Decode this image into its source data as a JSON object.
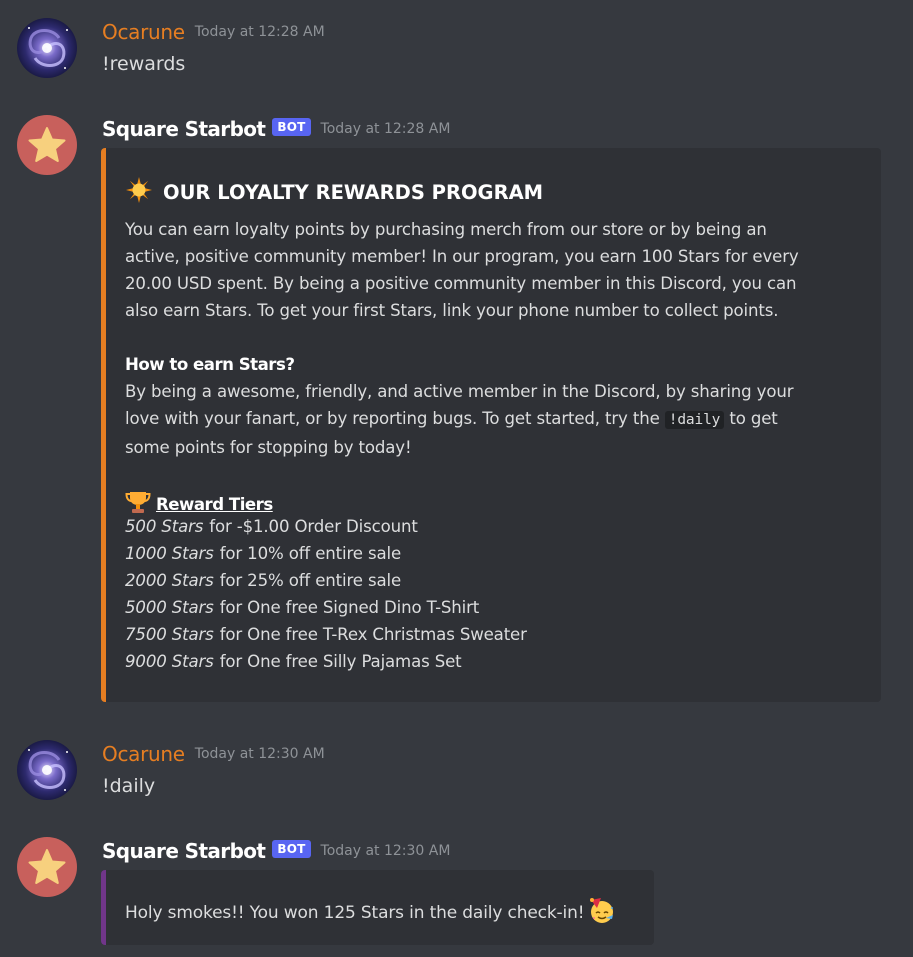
{
  "colors": {
    "background": "#36393f",
    "embed_background": "#2f3136",
    "user_name": "#e67e22",
    "bot_tag": "#5865f2",
    "rewards_embed_bar": "#e67e22",
    "daily_embed_bar": "#71368a",
    "timestamp": "#8e9297"
  },
  "messages": [
    {
      "author": "Ocarune",
      "timestamp": "Today at 12:28 AM",
      "avatar_icon": "galaxy-avatar-icon",
      "content": "!rewards"
    },
    {
      "author": "Square Starbot",
      "bot_tag": "BOT",
      "timestamp": "Today at 12:28 AM",
      "avatar_icon": "star-avatar-icon",
      "embed": {
        "title_icon": "sun-icon",
        "title": "OUR LOYALTY REWARDS PROGRAM",
        "intro_lines": [
          "You can earn loyalty points by purchasing merch from our store or by being an",
          "active, positive community member! In our program, you earn 100 Stars for every",
          "20.00 USD spent. By being a positive community member in this Discord, you can",
          "also earn Stars. To get your first Stars, link your phone number to collect points."
        ],
        "how_heading": "How to earn Stars?",
        "how_lines": [
          "By being a awesome, friendly, and active member in the Discord, by sharing your",
          "love with your fanart, or by reporting bugs. To get started, try the",
          "to get",
          "some points for stopping by today!"
        ],
        "how_command": "!daily",
        "tiers_icon": "trophy-icon",
        "tiers_heading": "Reward Tiers",
        "tiers": [
          {
            "stars": "500 Stars",
            "reward": "for -$1.00 Order Discount"
          },
          {
            "stars": "1000 Stars",
            "reward": "for 10% off entire sale"
          },
          {
            "stars": "2000 Stars",
            "reward": "for 25% off entire sale"
          },
          {
            "stars": "5000 Stars",
            "reward": "for One free Signed Dino T-Shirt"
          },
          {
            "stars": "7500 Stars",
            "reward": "for One free T-Rex Christmas Sweater"
          },
          {
            "stars": "9000 Stars",
            "reward": "for One free Silly Pajamas Set"
          }
        ]
      }
    },
    {
      "author": "Ocarune",
      "timestamp": "Today at 12:30 AM",
      "avatar_icon": "galaxy-avatar-icon",
      "content": "!daily"
    },
    {
      "author": "Square Starbot",
      "bot_tag": "BOT",
      "timestamp": "Today at 12:30 AM",
      "avatar_icon": "star-avatar-icon",
      "embed": {
        "text": "Holy smokes!! You won 125 Stars in the daily check-in!",
        "emoji_icon": "party-face-icon"
      }
    }
  ]
}
